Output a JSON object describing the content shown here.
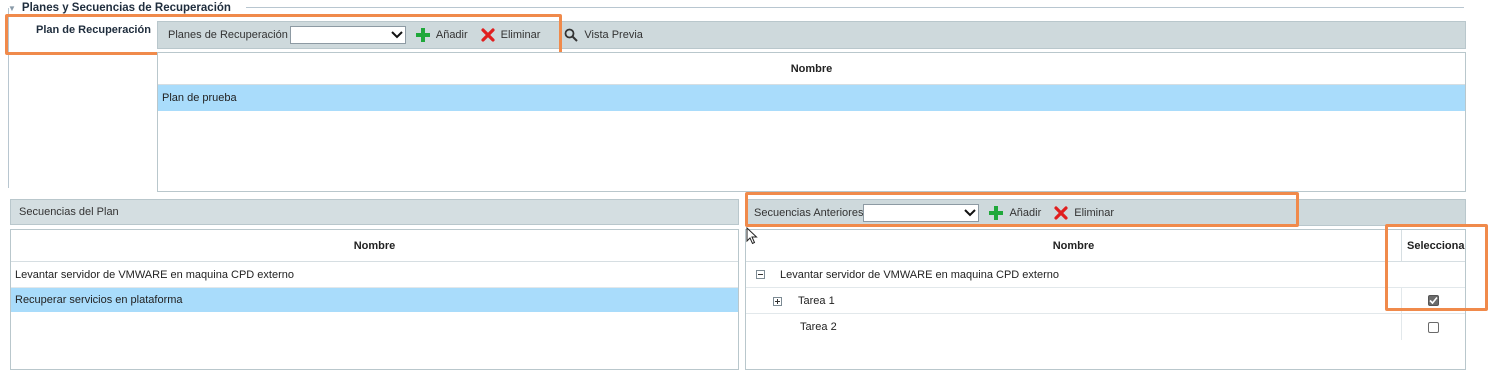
{
  "section": {
    "title": "Planes y Secuencias de Recuperación"
  },
  "plan_label": "Plan de Recuperación",
  "plans_toolbar": {
    "select_label": "Planes de Recuperación",
    "selected_value": "",
    "add_label": "Añadir",
    "delete_label": "Eliminar",
    "preview_label": "Vista Previa"
  },
  "plans_grid": {
    "header": "Nombre",
    "rows": [
      "Plan de prueba"
    ]
  },
  "sequences_panel": {
    "title": "Secuencias del Plan",
    "header": "Nombre",
    "rows": [
      "Levantar servidor de VMWARE en maquina CPD externo",
      "Recuperar servicios en plataforma"
    ]
  },
  "prev_toolbar": {
    "select_label": "Secuencias Anteriores",
    "selected_value": "",
    "add_label": "Añadir",
    "delete_label": "Eliminar"
  },
  "prev_grid": {
    "header_name": "Nombre",
    "header_selected": "Seleccionad",
    "rows": [
      {
        "label": "Levantar servidor de VMWARE en maquina CPD externo",
        "level": 0,
        "expander": "minus"
      },
      {
        "label": "Tarea 1",
        "level": 1,
        "expander": "plus",
        "checked": true
      },
      {
        "label": "Tarea 2",
        "level": 1,
        "expander": "",
        "checked": false
      }
    ]
  },
  "colors": {
    "highlight": "#f08a4b",
    "selected_row": "#a9dcfb",
    "toolbar": "#ced9dc",
    "add_icon": "#1fa83a",
    "delete_icon": "#e01f1f"
  },
  "icons": [
    "collapse-arrow-icon",
    "chevron-down-icon",
    "plus-icon",
    "close-icon",
    "search-icon",
    "mouse-cursor-icon",
    "tree-collapse-icon",
    "tree-expand-icon",
    "checkmark-icon"
  ]
}
